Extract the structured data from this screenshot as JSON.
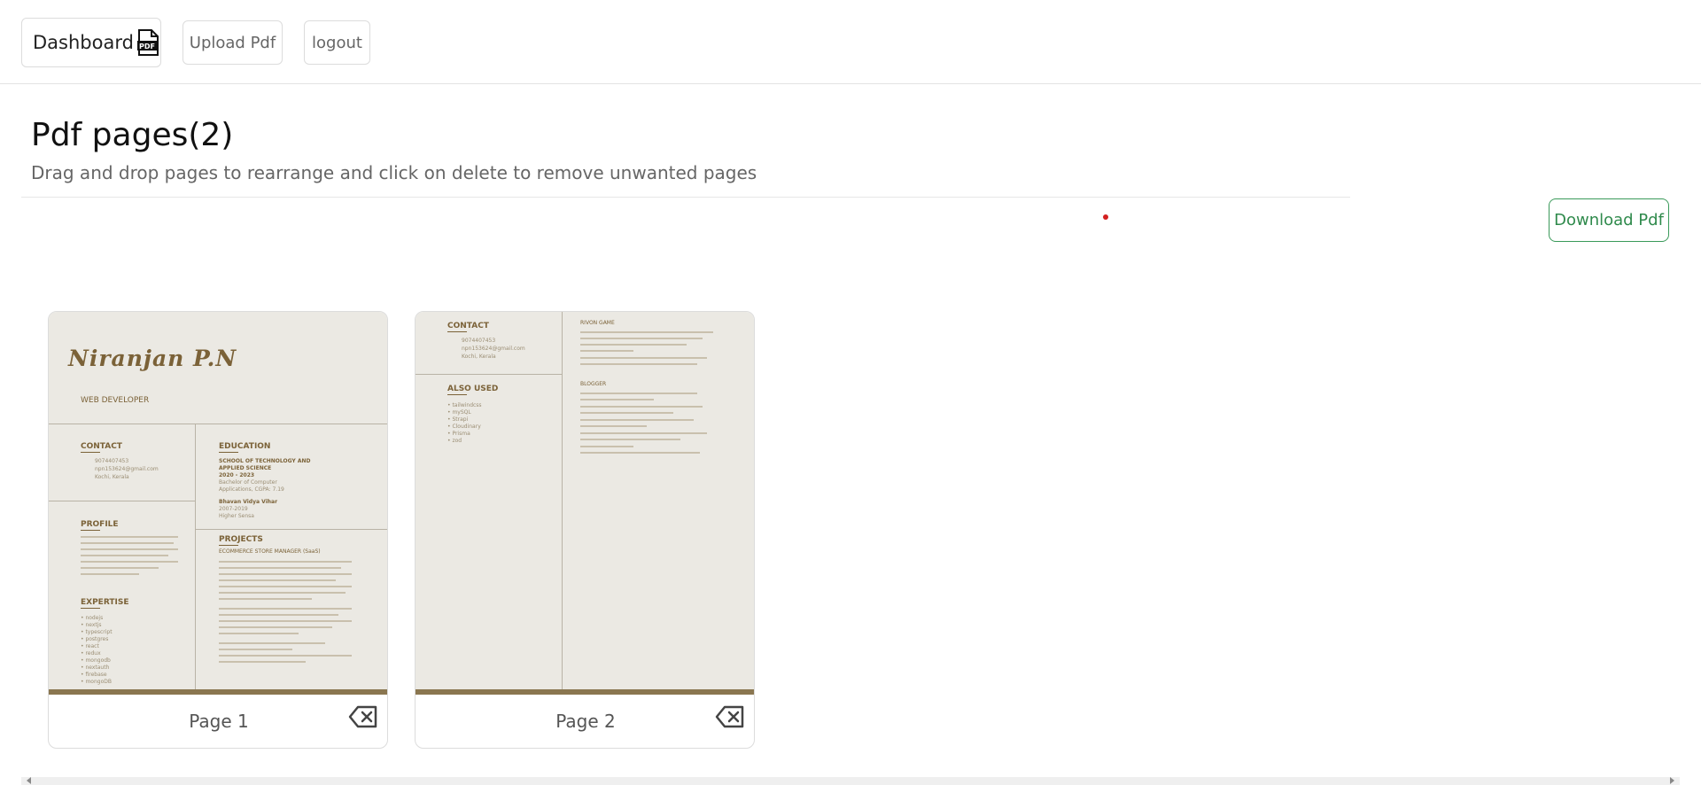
{
  "nav": {
    "dashboard_label": "Dashboard",
    "upload_label": "Upload Pdf",
    "logout_label": "logout"
  },
  "header": {
    "title": "Pdf pages(2)",
    "subtitle": "Drag and drop pages to rearrange and click on delete to remove unwanted pages"
  },
  "actions": {
    "download_label": "Download Pdf"
  },
  "pages": [
    {
      "label": "Page 1",
      "thumbnail": {
        "name": "Niranjan P.N",
        "role": "WEB DEVELOPER",
        "sections": {
          "contact": "CONTACT",
          "education": "EDUCATION",
          "profile": "PROFILE",
          "projects": "PROJECTS",
          "expertise": "EXPERTISE"
        },
        "contact_lines": [
          "9074407453",
          "npn153624@gmail.com",
          "Kochi, Kerala"
        ],
        "education_lines": [
          "SCHOOL OF TECHNOLOGY AND",
          "APPLIED SCIENCE",
          "2020 - 2023",
          "Bachelor of Computer",
          "Applications, CGPA: 7.19",
          "Bhavan Vidya Vihar",
          "2007-2019",
          "Higher Sensa"
        ],
        "project_title": "ECOMMERCE STORE MANAGER (SaaS)",
        "expertise_items": [
          "nodejs",
          "nextjs",
          "typescript",
          "postgres",
          "react",
          "redux",
          "mongodb",
          "nextauth",
          "firebase",
          "mongoDB"
        ]
      }
    },
    {
      "label": "Page 2",
      "thumbnail": {
        "sections": {
          "contact": "CONTACT",
          "also_used": "ALSO USED",
          "right_top": "RIVON GAME",
          "right_mid": "BLOGGER"
        },
        "contact_lines": [
          "9074407453",
          "npn153624@gmail.com",
          "Kochi, Kerala"
        ],
        "also_used_items": [
          "tailwindcss",
          "mySQL",
          "Strapi",
          "Cloudinary",
          "Prisma",
          "zod"
        ]
      }
    }
  ],
  "colors": {
    "download_accent": "#2f8a4c",
    "thumb_bg": "#ebe9e3",
    "thumb_accent": "#7b6238",
    "dot": "#d32020"
  },
  "icons": {
    "pdf": "pdf-file-icon",
    "delete": "backspace-delete-icon"
  }
}
